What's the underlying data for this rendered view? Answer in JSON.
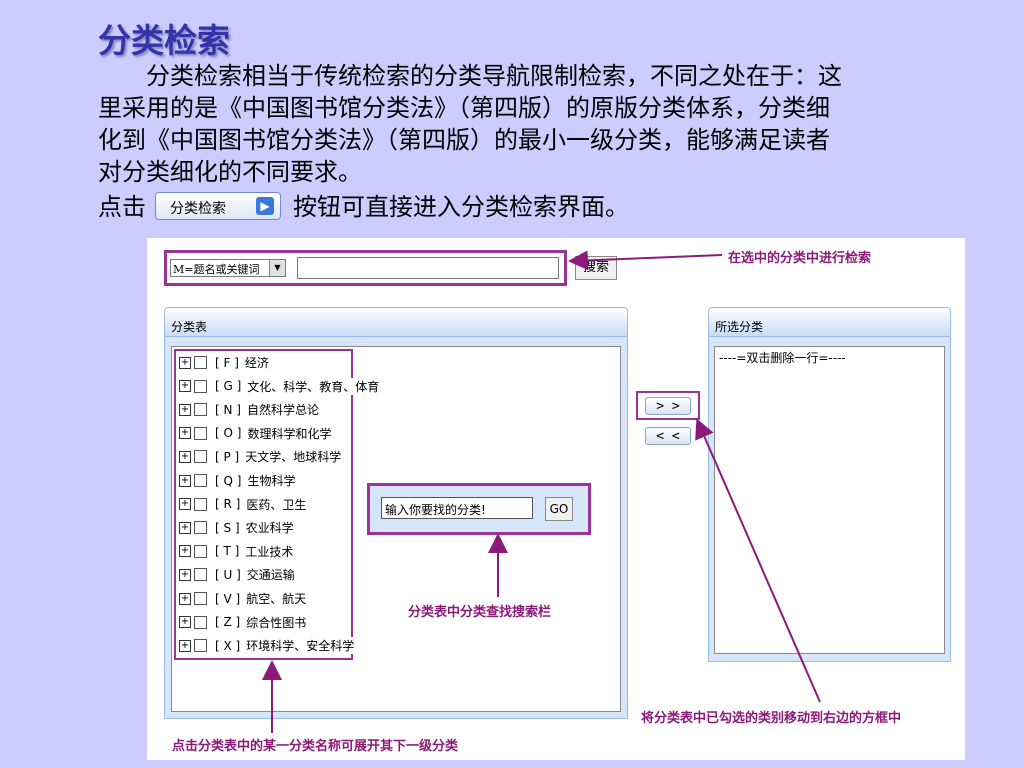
{
  "slide": {
    "title": "分类检索",
    "paragraph_lines": [
      "分类检索相当于传统检索的分类导航限制检索，不同之处在于：这",
      "里采用的是《中国图书馆分类法》（第四版）的原版分类体系，分类细",
      "化到《中国图书馆分类法》（第四版）的最小一级分类，能够满足读者",
      "对分类细化的不同要求。"
    ],
    "click_prefix": "点击",
    "inline_button_label": "分类检索",
    "inline_button_arrow": "▶",
    "click_suffix": "按钮可直接进入分类检索界面。"
  },
  "screenshot": {
    "search_select_value": "M=题名或关键词",
    "search_input_value": "",
    "search_button": "搜索",
    "left_panel_title": "分类表",
    "right_panel_title": "所选分类",
    "right_panel_hint": "----=双击删除一行=----",
    "categories": [
      {
        "code": "[ F ]",
        "name": "经济"
      },
      {
        "code": "[ G ]",
        "name": "文化、科学、教育、体育"
      },
      {
        "code": "[ N ]",
        "name": "自然科学总论"
      },
      {
        "code": "[ O ]",
        "name": "数理科学和化学"
      },
      {
        "code": "[ P ]",
        "name": "天文学、地球科学"
      },
      {
        "code": "[ Q ]",
        "name": "生物科学"
      },
      {
        "code": "[ R ]",
        "name": "医药、卫生"
      },
      {
        "code": "[ S ]",
        "name": "农业科学"
      },
      {
        "code": "[ T ]",
        "name": "工业技术"
      },
      {
        "code": "[ U ]",
        "name": "交通运输"
      },
      {
        "code": "[ V ]",
        "name": "航空、航天"
      },
      {
        "code": "[ Z ]",
        "name": "综合性图书"
      },
      {
        "code": "[ X ]",
        "name": "环境科学、安全科学"
      }
    ],
    "find_input_value": "输入你要找的分类!",
    "find_button": "GO",
    "add_button": "> >",
    "remove_button": "< <"
  },
  "annotations": {
    "search_in_selected": "在选中的分类中进行检索",
    "find_in_table": "分类表中分类查找搜索栏",
    "move_selected": "将分类表中已勾选的类别移动到右边的方框中",
    "expand_category": "点击分类表中的某一分类名称可展开其下一级分类"
  },
  "colors": {
    "background": "#ccccff",
    "title": "#3333aa",
    "annotation": "#8b1a7a",
    "highlight_box": "#993399"
  }
}
